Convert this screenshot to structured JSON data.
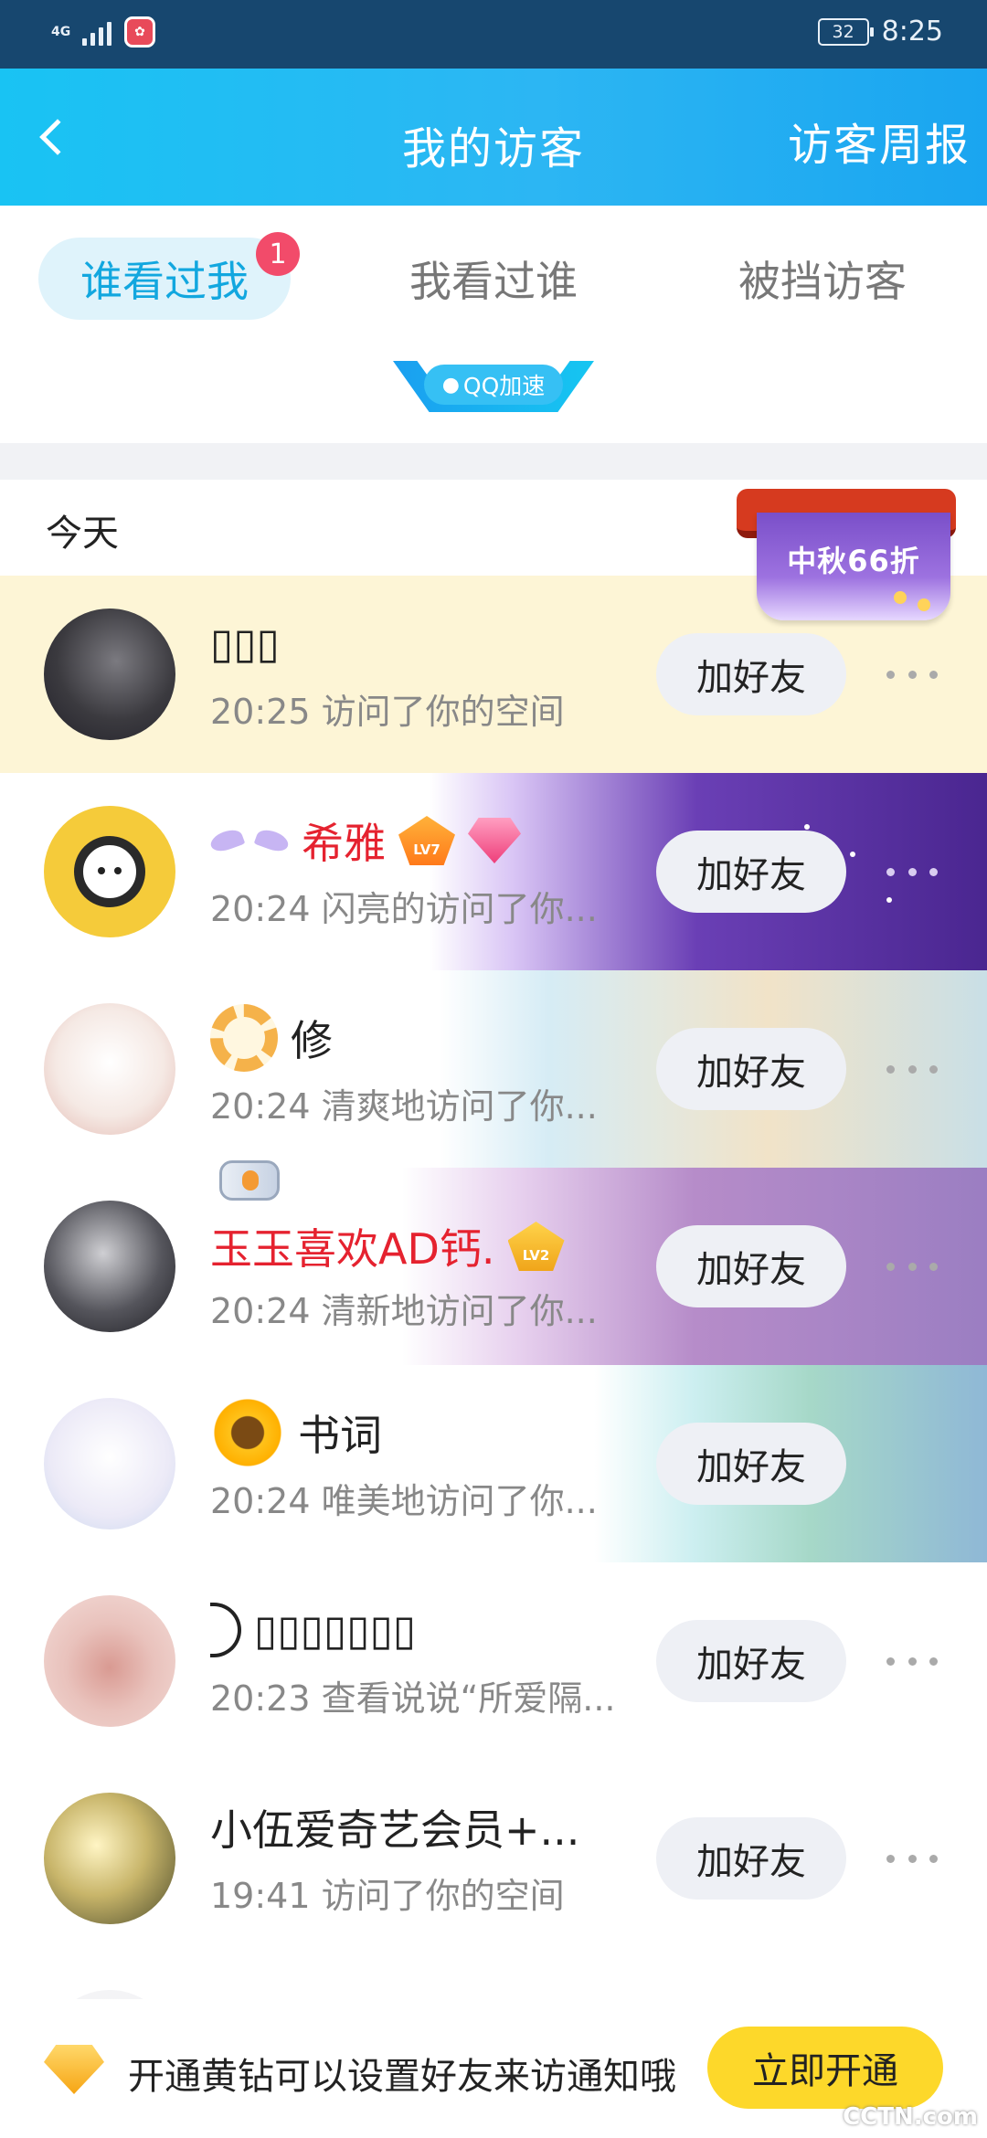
{
  "status_bar": {
    "network": "4G",
    "battery": "32",
    "time": "8:25"
  },
  "header": {
    "title": "我的访客",
    "weekly_report": "访客周报"
  },
  "tabs": [
    {
      "label": "谁看过我",
      "badge": "1",
      "active": true
    },
    {
      "label": "我看过谁"
    },
    {
      "label": "被挡访客"
    }
  ],
  "speed_badge": "QQ加速",
  "section": {
    "title": "今天"
  },
  "promo": {
    "text": "中秋66折"
  },
  "visitors": [
    {
      "name": "▯▯▯",
      "sub": "20:25 访问了你的空间",
      "action": "加好友"
    },
    {
      "name": "希雅",
      "badge": "LV7",
      "sub": "20:24 闪亮的访问了你...",
      "action": "加好友"
    },
    {
      "name": "修",
      "sub": "20:24 清爽地访问了你...",
      "action": "加好友"
    },
    {
      "name": "玉玉喜欢AD钙.",
      "badge": "LV2",
      "sub": "20:24 清新地访问了你...",
      "action": "加好友"
    },
    {
      "name": "书词",
      "sub": "20:24 唯美地访问了你...",
      "action": "加好友"
    },
    {
      "name": "▯▯▯▯▯▯▯",
      "sub": "20:23 查看说说“所爱隔...",
      "action": "加好友"
    },
    {
      "name": "小伍爱奇艺会员+...",
      "sub": "19:41 访问了你的空间",
      "action": "加好友"
    }
  ],
  "banner": {
    "message": "开通黄钻可以设置好友来访通知哦",
    "cta": "立即开通"
  },
  "watermark": "CCTN.com",
  "colors": {
    "header": "#19c3f3",
    "status_bar": "#17476f",
    "name_highlight": "#e5222f",
    "cta": "#fdd82a",
    "tab_active": "#12a7df",
    "badge": "#f24b6a"
  }
}
